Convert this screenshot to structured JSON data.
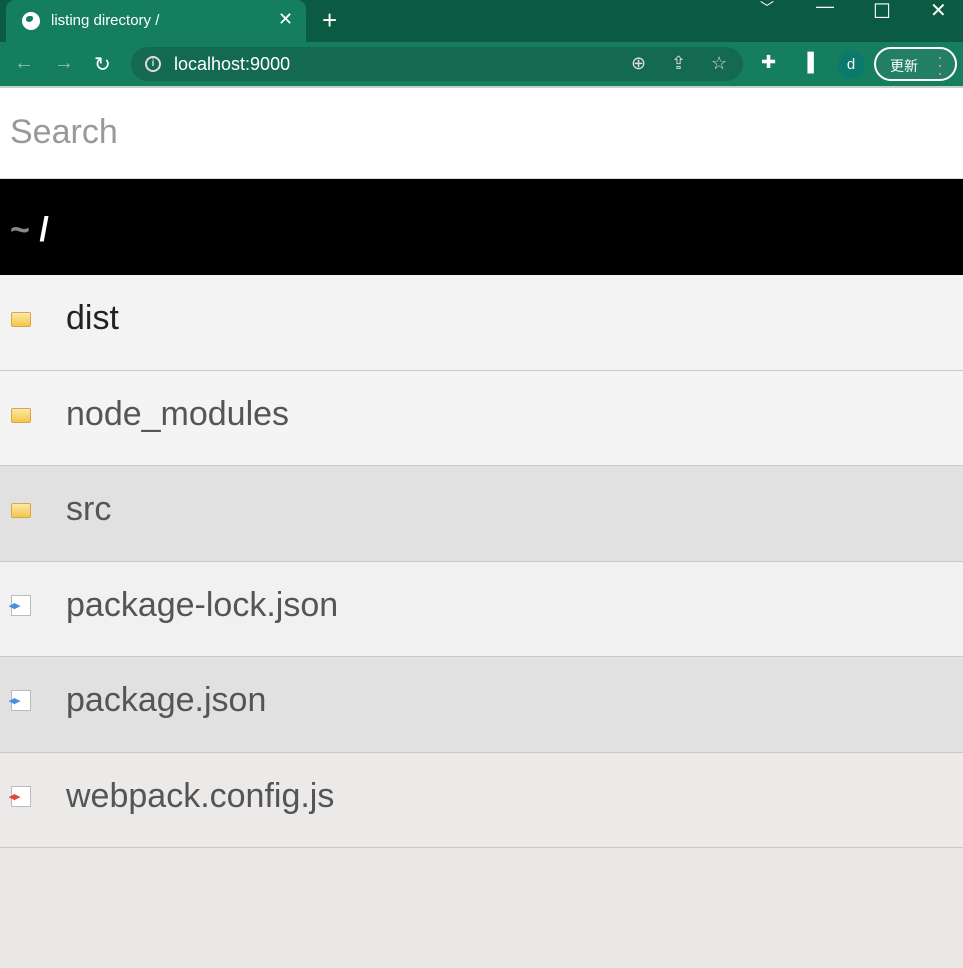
{
  "browser": {
    "tab_title": "listing directory /",
    "url": "localhost:9000",
    "update_label": "更新",
    "profile_initial": "d"
  },
  "search": {
    "placeholder": "Search",
    "value": ""
  },
  "breadcrumb": {
    "home": "~",
    "root": "/"
  },
  "files": [
    {
      "name": "dist",
      "type": "folder",
      "bg": "#f3f3f3",
      "color": "#222"
    },
    {
      "name": "node_modules",
      "type": "folder",
      "bg": "#f5f4f4",
      "color": "#555"
    },
    {
      "name": "src",
      "type": "folder",
      "bg": "#e1e1e1",
      "color": "#555"
    },
    {
      "name": "package-lock.json",
      "type": "json",
      "bg": "#f2f1f1",
      "color": "#555",
      "icon_color": "#4a90e2"
    },
    {
      "name": "package.json",
      "type": "json",
      "bg": "#e1e1e1",
      "color": "#555",
      "icon_color": "#4a90e2"
    },
    {
      "name": "webpack.config.js",
      "type": "js",
      "bg": "#ebeae9",
      "color": "#555",
      "icon_color": "#e04848"
    }
  ]
}
